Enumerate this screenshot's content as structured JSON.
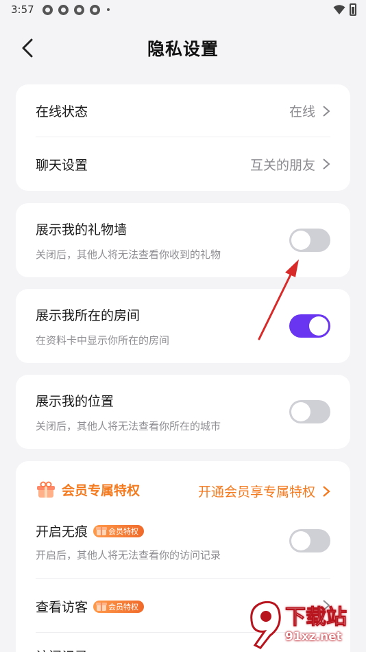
{
  "status_bar": {
    "time": "3:57"
  },
  "header": {
    "title": "隐私设置"
  },
  "card1": {
    "rows": [
      {
        "title": "在线状态",
        "value": "在线"
      },
      {
        "title": "聊天设置",
        "value": "互关的朋友"
      }
    ]
  },
  "gift_wall": {
    "title": "展示我的礼物墙",
    "desc": "关闭后，其他人将无法查看你收到的礼物",
    "enabled": false
  },
  "room": {
    "title": "展示我所在的房间",
    "desc": "在资料卡中显示你所在的房间",
    "enabled": true
  },
  "location": {
    "title": "展示我的位置",
    "desc": "关闭后，其他人将无法查看你所在的城市",
    "enabled": false
  },
  "vip": {
    "title": "会员专属特权",
    "link": "开通会员享专属特权",
    "badge": "会员特权",
    "stealth": {
      "title": "开启无痕",
      "desc": "开启后，其他人将无法查看你的访问记录",
      "enabled": false
    },
    "visitors": {
      "title": "查看访客"
    },
    "next_row_partial": "访问记录"
  },
  "watermark": {
    "text": "下载站",
    "url": "91xz.net"
  },
  "colors": {
    "accent": "#6a35f0",
    "vip_orange": "#f47a1f",
    "toggle_off": "#cfcfd6"
  }
}
